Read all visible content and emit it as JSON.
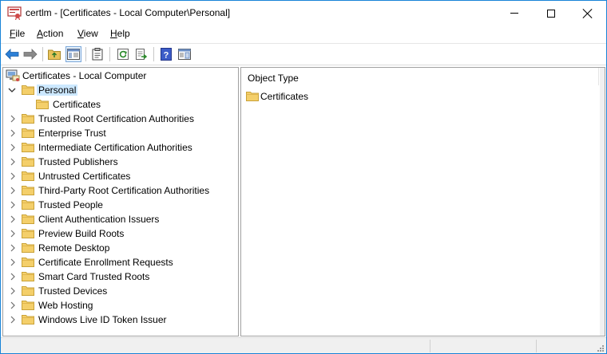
{
  "window": {
    "title": "certlm - [Certificates - Local Computer\\Personal]"
  },
  "menu": [
    {
      "key": "F",
      "rest": "ile"
    },
    {
      "key": "A",
      "rest": "ction"
    },
    {
      "key": "V",
      "rest": "iew"
    },
    {
      "key": "H",
      "rest": "elp"
    }
  ],
  "toolbar": {
    "buttons": [
      "back-arrow-icon",
      "forward-arrow-icon",
      "up-folder-icon",
      "show-hide-tree-icon",
      "clipboard-icon",
      "refresh-icon",
      "export-list-icon",
      "help-icon",
      "properties-icon"
    ]
  },
  "tree": {
    "root": "Certificates - Local Computer",
    "selected": "Personal",
    "personal_child": "Certificates",
    "items": [
      "Personal",
      "Trusted Root Certification Authorities",
      "Enterprise Trust",
      "Intermediate Certification Authorities",
      "Trusted Publishers",
      "Untrusted Certificates",
      "Third-Party Root Certification Authorities",
      "Trusted People",
      "Client Authentication Issuers",
      "Preview Build Roots",
      "Remote Desktop",
      "Certificate Enrollment Requests",
      "Smart Card Trusted Roots",
      "Trusted Devices",
      "Web Hosting",
      "Windows Live ID Token Issuer"
    ]
  },
  "list": {
    "column_header": "Object Type",
    "rows": [
      "Certificates"
    ]
  },
  "colors": {
    "selection": "#cce8ff",
    "folder": "#f4cf6a",
    "accent": "#1883d7"
  }
}
